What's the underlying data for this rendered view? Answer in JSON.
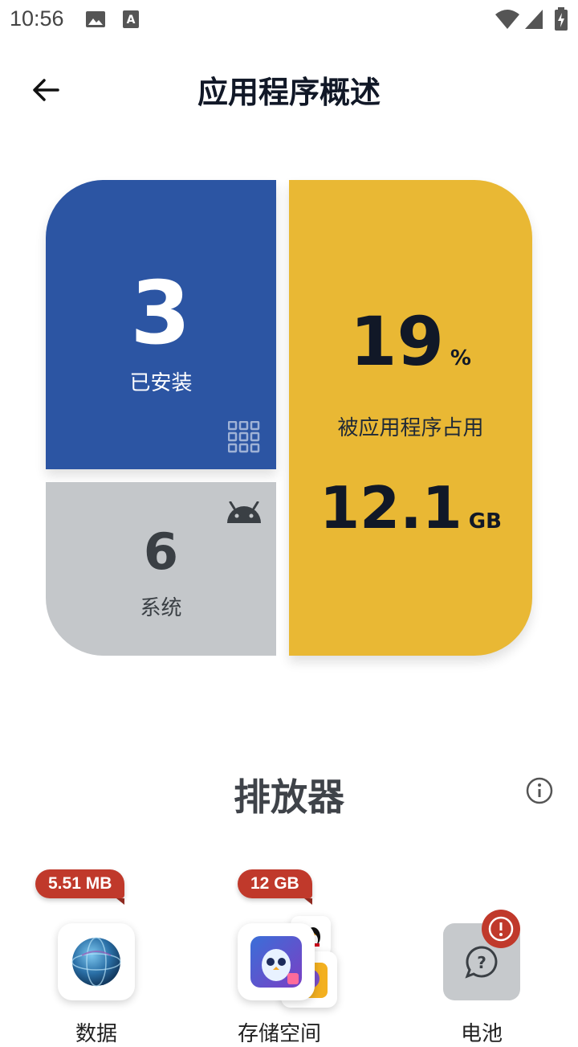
{
  "status_bar": {
    "time": "10:56",
    "icons": [
      "image-icon",
      "text-a-icon",
      "wifi-icon",
      "signal-icon",
      "battery-icon"
    ]
  },
  "header": {
    "title": "应用程序概述",
    "back_icon": "arrow-left-icon"
  },
  "summary": {
    "installed": {
      "count": "3",
      "label": "已安装",
      "icon": "grid-icon"
    },
    "system": {
      "count": "6",
      "label": "系统",
      "icon": "android-icon"
    },
    "storage": {
      "percent": "19",
      "percent_unit": "%",
      "label": "被应用程序占用",
      "size": "12.1",
      "size_unit": "GB"
    }
  },
  "drainers": {
    "title": "排放器",
    "info_icon": "info-icon",
    "items": [
      {
        "badge": "5.51 MB",
        "label": "数据",
        "icon": "globe-app-icon"
      },
      {
        "badge": "12 GB",
        "label": "存储空间",
        "icon": "game-app-stack-icon"
      },
      {
        "badge": "",
        "label": "电池",
        "icon": "question-icon"
      }
    ]
  },
  "colors": {
    "installed_card": "#2c55a3",
    "system_card": "#c4c7ca",
    "storage_card": "#e9b834",
    "badge": "#c0392b"
  }
}
